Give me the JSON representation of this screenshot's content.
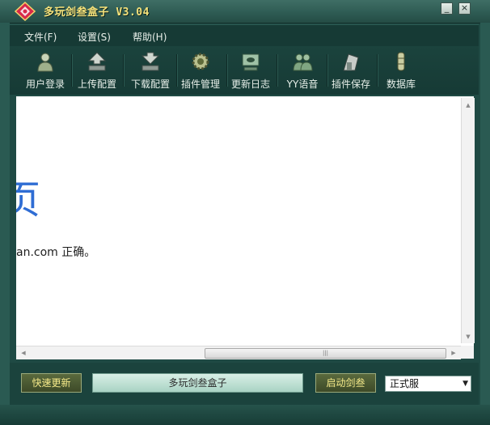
{
  "window": {
    "title": "多玩剑叁盒子 V3.04",
    "minimize_label": "_",
    "close_label": "×"
  },
  "menu": [
    {
      "label": "文件(F)"
    },
    {
      "label": "设置(S)"
    },
    {
      "label": "帮助(H)"
    }
  ],
  "toolbar": [
    {
      "label": "用户登录",
      "icon": "user-login-icon"
    },
    {
      "label": "上传配置",
      "icon": "upload-config-icon"
    },
    {
      "label": "下载配置",
      "icon": "download-config-icon"
    },
    {
      "label": "插件管理",
      "icon": "plugin-manage-icon"
    },
    {
      "label": "更新日志",
      "icon": "update-log-icon"
    },
    {
      "label": "YY语音",
      "icon": "yy-voice-icon"
    },
    {
      "label": "插件保存",
      "icon": "plugin-save-icon"
    },
    {
      "label": "数据库",
      "icon": "database-icon"
    }
  ],
  "content": {
    "heading_fragment": "页",
    "body_fragment": "an.com 正确。"
  },
  "scrollbar": {
    "up": "▲",
    "down": "▼",
    "left": "◀",
    "right": "▶",
    "grip": "|||"
  },
  "bottom": {
    "quick_update": "快速更新",
    "progress_text": "多玩剑叁盒子",
    "launch": "启动剑叁",
    "server_selected": "正式服",
    "dropdown_arrow": "▼"
  }
}
